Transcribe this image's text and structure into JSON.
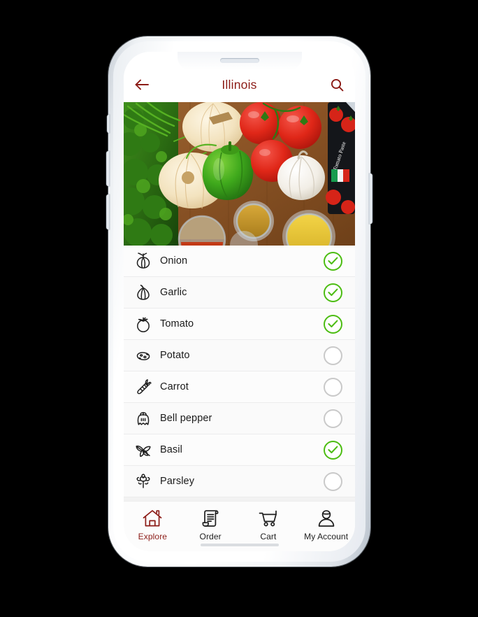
{
  "theme": {
    "accent": "#8c1c17",
    "check_green": "#4cbd12",
    "unchecked_gray": "#c9c9c9",
    "screen_bg": "#ffffff",
    "row_bg": "#fcfcfc",
    "text": "#1b1b1b"
  },
  "header": {
    "title": "Illinois",
    "back_icon": "arrow-left-icon",
    "search_icon": "search-icon"
  },
  "hero": {
    "alt": "Fresh vegetables and spices on a wooden cutting board",
    "subjects": [
      "parsley",
      "onion",
      "green bell pepper",
      "tomatoes",
      "garlic",
      "spice bowls",
      "tomato paste package"
    ]
  },
  "ingredients": [
    {
      "label": "Onion",
      "icon": "onion-icon",
      "checked": true
    },
    {
      "label": "Garlic",
      "icon": "garlic-icon",
      "checked": true
    },
    {
      "label": "Tomato",
      "icon": "tomato-icon",
      "checked": true
    },
    {
      "label": "Potato",
      "icon": "potato-icon",
      "checked": false
    },
    {
      "label": "Carrot",
      "icon": "carrot-icon",
      "checked": false
    },
    {
      "label": "Bell pepper",
      "icon": "bell-pepper-icon",
      "checked": false
    },
    {
      "label": "Basil",
      "icon": "basil-icon",
      "checked": true
    },
    {
      "label": "Parsley",
      "icon": "parsley-icon",
      "checked": false
    }
  ],
  "bottom_nav": {
    "active": "Explore",
    "items": [
      {
        "label": "Explore",
        "icon": "home-icon",
        "active": true
      },
      {
        "label": "Order",
        "icon": "receipt-icon",
        "active": false
      },
      {
        "label": "Cart",
        "icon": "cart-icon",
        "active": false
      },
      {
        "label": "My Account",
        "icon": "person-icon",
        "active": false
      }
    ]
  }
}
